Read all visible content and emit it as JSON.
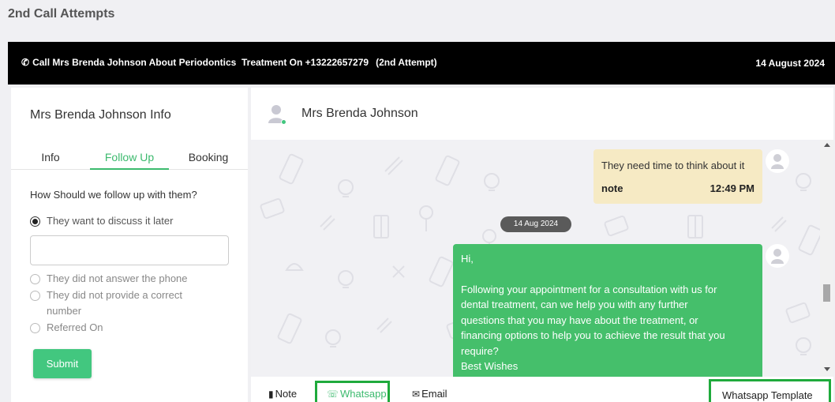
{
  "page": {
    "title": "2nd Call Attempts"
  },
  "banner": {
    "call_text": "Call Mrs Brenda Johnson About Periodontics  Treatment On +13222657279",
    "attempt": "(2nd Attempt)",
    "date": "14 August 2024"
  },
  "left_panel": {
    "title": "Mrs Brenda Johnson Info",
    "tabs": [
      {
        "label": "Info",
        "active": false
      },
      {
        "label": "Follow Up",
        "active": true
      },
      {
        "label": "Booking",
        "active": false
      }
    ],
    "question": "How Should we follow up with them?",
    "options": [
      {
        "label": "They want to discuss it later",
        "checked": true
      },
      {
        "label": "They did not answer the phone",
        "checked": false
      },
      {
        "label": "They did not provide a correct",
        "label_line2": "number",
        "checked": false
      },
      {
        "label": "Referred On",
        "checked": false
      }
    ],
    "text_field_value": "",
    "submit_label": "Submit"
  },
  "chat": {
    "contact_name": "Mrs Brenda Johnson",
    "note_message": {
      "text": "They need time to think about it",
      "label": "note",
      "time": "12:49 PM"
    },
    "date_separator": "14 Aug 2024",
    "whatsapp_message": {
      "lines": [
        "Hi,",
        "",
        "Following your appointment for a consultation with us for",
        "dental treatment, can we help you with any further",
        "questions that you may have about the treatment, or",
        "financing options to help you to achieve the result that you",
        "require?",
        "Best Wishes"
      ]
    },
    "footer": {
      "note_label": "Note",
      "whatsapp_label": "Whatsapp",
      "email_label": "Email",
      "template_label": "Whatsapp Template"
    }
  },
  "colors": {
    "accent_green": "#42c77f",
    "whatsapp_bubble": "#45bf6b",
    "note_bubble": "#f6eac4",
    "banner_bg": "#000000",
    "highlight_border": "#1faa3c"
  }
}
